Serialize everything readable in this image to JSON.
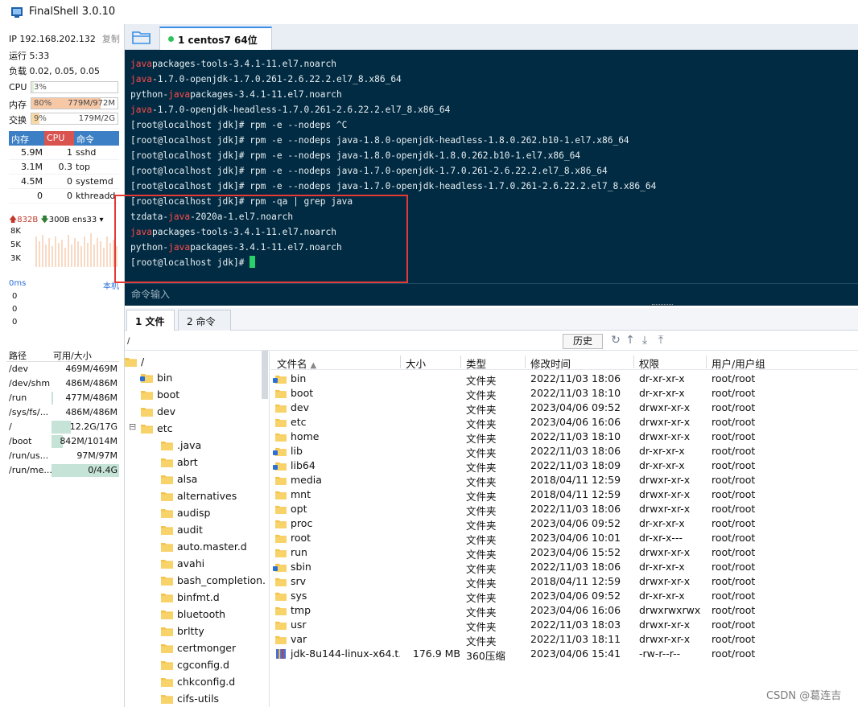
{
  "window": {
    "title": "FinalShell 3.0.10",
    "icon": "finalshell-app-icon"
  },
  "sysinfo": {
    "ip_line": "IP 192.168.202.132",
    "copy_label": "复制",
    "uptime": "运行 5:33",
    "load": "负载 0.02, 0.05, 0.05",
    "cpu": {
      "label": "CPU",
      "percent_text": "3%",
      "fraction": 0.03
    },
    "mem": {
      "label": "内存",
      "percent_text": "80%",
      "amount": "779M/972M",
      "fraction": 0.8
    },
    "swap": {
      "label": "交换",
      "percent_text": "9%",
      "amount": "179M/2G",
      "fraction": 0.09
    }
  },
  "processes": {
    "headers": {
      "mem": "内存",
      "cpu": "CPU",
      "cmd": "命令"
    },
    "rows": [
      {
        "mem": "5.9M",
        "cpu": "1",
        "cmd": "sshd"
      },
      {
        "mem": "3.1M",
        "cpu": "0.3",
        "cmd": "top"
      },
      {
        "mem": "4.5M",
        "cpu": "0",
        "cmd": "systemd"
      },
      {
        "mem": "0",
        "cpu": "0",
        "cmd": "kthreadd"
      }
    ]
  },
  "network": {
    "up": "832B",
    "down": "300B",
    "interface": "ens33",
    "scale": [
      "8K",
      "5K",
      "3K"
    ]
  },
  "latency": {
    "label": "0ms",
    "host_label": "本机",
    "values": [
      "0",
      "0",
      "0"
    ]
  },
  "disks": {
    "headers": {
      "path": "路径",
      "avail": "可用/大小"
    },
    "rows": [
      {
        "path": "/dev",
        "avail": "469M/469M",
        "used_fraction": 0.0
      },
      {
        "path": "/dev/shm",
        "avail": "486M/486M",
        "used_fraction": 0.0
      },
      {
        "path": "/run",
        "avail": "477M/486M",
        "used_fraction": 0.02
      },
      {
        "path": "/sys/fs/...",
        "avail": "486M/486M",
        "used_fraction": 0.0
      },
      {
        "path": "/",
        "avail": "12.2G/17G",
        "used_fraction": 0.28
      },
      {
        "path": "/boot",
        "avail": "842M/1014M",
        "used_fraction": 0.17
      },
      {
        "path": "/run/us...",
        "avail": "97M/97M",
        "used_fraction": 0.0
      },
      {
        "path": "/run/me...",
        "avail": "0/4.4G",
        "used_fraction": 1.0
      }
    ]
  },
  "session_tabs": [
    {
      "label": "1 centos7 64位",
      "status_color": "#2ec25a"
    }
  ],
  "terminal": {
    "lines": [
      {
        "pre": "",
        "hl": "java",
        "post": "packages-tools-3.4.1-11.el7.noarch"
      },
      {
        "pre": "",
        "hl": "java",
        "post": "-1.7.0-openjdk-1.7.0.261-2.6.22.2.el7_8.x86_64"
      },
      {
        "pre": "python-",
        "hl": "java",
        "post": "packages-3.4.1-11.el7.noarch"
      },
      {
        "pre": "",
        "hl": "java",
        "post": "-1.7.0-openjdk-headless-1.7.0.261-2.6.22.2.el7_8.x86_64"
      },
      {
        "pre": "[root@localhost jdk]# rpm -e --nodeps ^C",
        "hl": "",
        "post": ""
      },
      {
        "pre": "[root@localhost jdk]# rpm -e --nodeps java-1.8.0-openjdk-headless-1.8.0.262.b10-1.el7.x86_64",
        "hl": "",
        "post": ""
      },
      {
        "pre": "[root@localhost jdk]# rpm -e --nodeps java-1.8.0-openjdk-1.8.0.262.b10-1.el7.x86_64",
        "hl": "",
        "post": ""
      },
      {
        "pre": "[root@localhost jdk]# rpm -e --nodeps java-1.7.0-openjdk-1.7.0.261-2.6.22.2.el7_8.x86_64",
        "hl": "",
        "post": ""
      },
      {
        "pre": "[root@localhost jdk]# rpm -e --nodeps java-1.7.0-openjdk-headless-1.7.0.261-2.6.22.2.el7_8.x86_64",
        "hl": "",
        "post": ""
      },
      {
        "pre": "[root@localhost jdk]# rpm -qa | grep java",
        "hl": "",
        "post": ""
      },
      {
        "pre": "tzdata-",
        "hl": "java",
        "post": "-2020a-1.el7.noarch"
      },
      {
        "pre": "",
        "hl": "java",
        "post": "packages-tools-3.4.1-11.el7.noarch"
      },
      {
        "pre": "python-",
        "hl": "java",
        "post": "packages-3.4.1-11.el7.noarch"
      },
      {
        "pre": "[root@localhost jdk]# ",
        "hl": "",
        "post": ""
      }
    ],
    "input_placeholder": "命令输入",
    "highlight_color": "#ff4a4a"
  },
  "bottom_tabs": {
    "files": "1 文件",
    "commands": "2 命令"
  },
  "pathbar": {
    "path": "/",
    "history_label": "历史"
  },
  "tree": {
    "root": "/",
    "items": [
      {
        "label": "bin",
        "level": 1,
        "link": true
      },
      {
        "label": "boot",
        "level": 1,
        "link": false
      },
      {
        "label": "dev",
        "level": 1,
        "link": false
      },
      {
        "label": "etc",
        "level": 1,
        "link": false,
        "expanded": true
      },
      {
        "label": ".java",
        "level": 2
      },
      {
        "label": "abrt",
        "level": 2
      },
      {
        "label": "alsa",
        "level": 2
      },
      {
        "label": "alternatives",
        "level": 2
      },
      {
        "label": "audisp",
        "level": 2
      },
      {
        "label": "audit",
        "level": 2
      },
      {
        "label": "auto.master.d",
        "level": 2
      },
      {
        "label": "avahi",
        "level": 2
      },
      {
        "label": "bash_completion.",
        "level": 2
      },
      {
        "label": "binfmt.d",
        "level": 2
      },
      {
        "label": "bluetooth",
        "level": 2
      },
      {
        "label": "brltty",
        "level": 2
      },
      {
        "label": "certmonger",
        "level": 2
      },
      {
        "label": "cgconfig.d",
        "level": 2
      },
      {
        "label": "chkconfig.d",
        "level": 2
      },
      {
        "label": "cifs-utils",
        "level": 2
      }
    ]
  },
  "filelist": {
    "headers": {
      "name": "文件名",
      "size": "大小",
      "type": "类型",
      "mtime": "修改时间",
      "perm": "权限",
      "owner": "用户/用户组"
    },
    "rows": [
      {
        "name": "bin",
        "size": "",
        "type": "文件夹",
        "mtime": "2022/11/03 18:06",
        "perm": "dr-xr-xr-x",
        "owner": "root/root",
        "link": true
      },
      {
        "name": "boot",
        "size": "",
        "type": "文件夹",
        "mtime": "2022/11/03 18:10",
        "perm": "dr-xr-xr-x",
        "owner": "root/root"
      },
      {
        "name": "dev",
        "size": "",
        "type": "文件夹",
        "mtime": "2023/04/06 09:52",
        "perm": "drwxr-xr-x",
        "owner": "root/root"
      },
      {
        "name": "etc",
        "size": "",
        "type": "文件夹",
        "mtime": "2023/04/06 16:06",
        "perm": "drwxr-xr-x",
        "owner": "root/root"
      },
      {
        "name": "home",
        "size": "",
        "type": "文件夹",
        "mtime": "2022/11/03 18:10",
        "perm": "drwxr-xr-x",
        "owner": "root/root"
      },
      {
        "name": "lib",
        "size": "",
        "type": "文件夹",
        "mtime": "2022/11/03 18:06",
        "perm": "dr-xr-xr-x",
        "owner": "root/root",
        "link": true
      },
      {
        "name": "lib64",
        "size": "",
        "type": "文件夹",
        "mtime": "2022/11/03 18:09",
        "perm": "dr-xr-xr-x",
        "owner": "root/root",
        "link": true
      },
      {
        "name": "media",
        "size": "",
        "type": "文件夹",
        "mtime": "2018/04/11 12:59",
        "perm": "drwxr-xr-x",
        "owner": "root/root"
      },
      {
        "name": "mnt",
        "size": "",
        "type": "文件夹",
        "mtime": "2018/04/11 12:59",
        "perm": "drwxr-xr-x",
        "owner": "root/root"
      },
      {
        "name": "opt",
        "size": "",
        "type": "文件夹",
        "mtime": "2022/11/03 18:06",
        "perm": "drwxr-xr-x",
        "owner": "root/root"
      },
      {
        "name": "proc",
        "size": "",
        "type": "文件夹",
        "mtime": "2023/04/06 09:52",
        "perm": "dr-xr-xr-x",
        "owner": "root/root"
      },
      {
        "name": "root",
        "size": "",
        "type": "文件夹",
        "mtime": "2023/04/06 10:01",
        "perm": "dr-xr-x---",
        "owner": "root/root"
      },
      {
        "name": "run",
        "size": "",
        "type": "文件夹",
        "mtime": "2023/04/06 15:52",
        "perm": "drwxr-xr-x",
        "owner": "root/root"
      },
      {
        "name": "sbin",
        "size": "",
        "type": "文件夹",
        "mtime": "2022/11/03 18:06",
        "perm": "dr-xr-xr-x",
        "owner": "root/root",
        "link": true
      },
      {
        "name": "srv",
        "size": "",
        "type": "文件夹",
        "mtime": "2018/04/11 12:59",
        "perm": "drwxr-xr-x",
        "owner": "root/root"
      },
      {
        "name": "sys",
        "size": "",
        "type": "文件夹",
        "mtime": "2023/04/06 09:52",
        "perm": "dr-xr-xr-x",
        "owner": "root/root"
      },
      {
        "name": "tmp",
        "size": "",
        "type": "文件夹",
        "mtime": "2023/04/06 16:06",
        "perm": "drwxrwxrwx",
        "owner": "root/root"
      },
      {
        "name": "usr",
        "size": "",
        "type": "文件夹",
        "mtime": "2022/11/03 18:03",
        "perm": "drwxr-xr-x",
        "owner": "root/root"
      },
      {
        "name": "var",
        "size": "",
        "type": "文件夹",
        "mtime": "2022/11/03 18:11",
        "perm": "drwxr-xr-x",
        "owner": "root/root"
      },
      {
        "name": "jdk-8u144-linux-x64.t...",
        "size": "176.9 MB",
        "type": "360压缩",
        "mtime": "2023/04/06 15:41",
        "perm": "-rw-r--r--",
        "owner": "root/root",
        "archive": true
      }
    ]
  },
  "watermark": "CSDN @葛连吉",
  "colors": {
    "accent": "#3b8ee8",
    "terminal_bg": "#012b42",
    "folder": "#f5c34a",
    "annotation_box": "#e53935",
    "proc_header_mem": "#3d7fc4",
    "proc_header_cpu": "#d9534f"
  }
}
